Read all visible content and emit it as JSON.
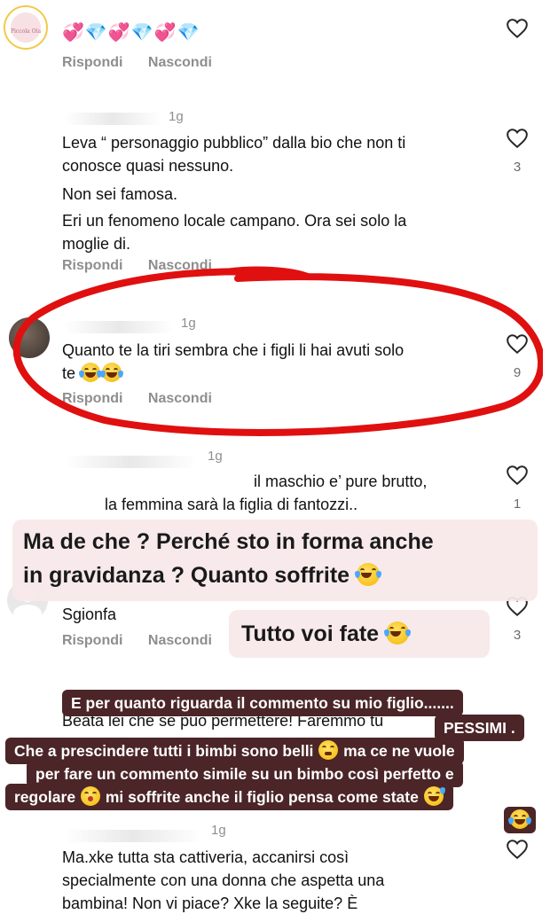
{
  "comments": [
    {
      "id": "c0",
      "emoji_row": "💞💎💞💎💞💎",
      "avatar_label": "Piccola Ola",
      "reply_label": "Rispondi",
      "hide_label": "Nascondi"
    },
    {
      "id": "c1",
      "time": "1g",
      "text_lines": [
        "Leva “ personaggio pubblico” dalla bio che non ti",
        "conosce quasi nessuno.",
        "Non sei famosa.",
        "Eri un fenomeno locale campano. Ora sei solo la",
        "moglie di."
      ],
      "likes": "3",
      "reply_label": "Rispondi",
      "hide_label": "Nascondi"
    },
    {
      "id": "c2",
      "time": "1g",
      "text_lines": [
        "Quanto te la tiri sembra che i figli li hai avuti solo",
        "te"
      ],
      "likes": "9",
      "reply_label": "Rispondi",
      "hide_label": "Nascondi"
    },
    {
      "id": "c3",
      "time": "1g",
      "text_lines": [
        "il maschio e’ pure brutto,",
        "la femmina sarà la figlia di fantozzi.."
      ],
      "likes": "1"
    },
    {
      "id": "c4",
      "text_lines": [
        "Sgionfa"
      ],
      "likes": "3",
      "reply_label": "Rispondi",
      "hide_label": "Nascondi"
    },
    {
      "id": "c5",
      "text_lines": [
        "Beata lei che se può permettere! Faremmo tu"
      ]
    },
    {
      "id": "c6",
      "time": "1g",
      "text_lines": [
        "Ma.xke tutta sta cattiveria, accanirsi così",
        "specialmente con una donna che aspetta una",
        "bambina! Non vi piace? Xke la seguite?  È"
      ]
    }
  ],
  "overlays": {
    "light_caption_1_line1": "Ma de che ? Perché sto in forma anche",
    "light_caption_1_line2": "in gravidanza ?  Quanto soffrite",
    "light_caption_2": "Tutto voi fate",
    "dark_lines": [
      "E per quanto riguarda il commento su mio figlio.......",
      "PESSIMI .",
      "Che a prescindere tutti i bimbi sono belli",
      "ma ce ne vuole",
      "per fare un commento simile su un bimbo così perfetto e",
      "regolare",
      "mi soffrite anche il figlio pensa come state"
    ]
  },
  "icons": {
    "heart": "heart-outline-icon",
    "laughing": "tears-of-joy-emoji",
    "pleading": "pleading-face-emoji",
    "kiss": "face-blowing-kiss-emoji",
    "sweat": "grinning-sweat-emoji"
  },
  "colors": {
    "annotation_red": "#e01010",
    "dark_caption_bg": "#4b2527",
    "light_caption_bg": "#f8e9e9",
    "muted_text": "#8e8e8e"
  }
}
